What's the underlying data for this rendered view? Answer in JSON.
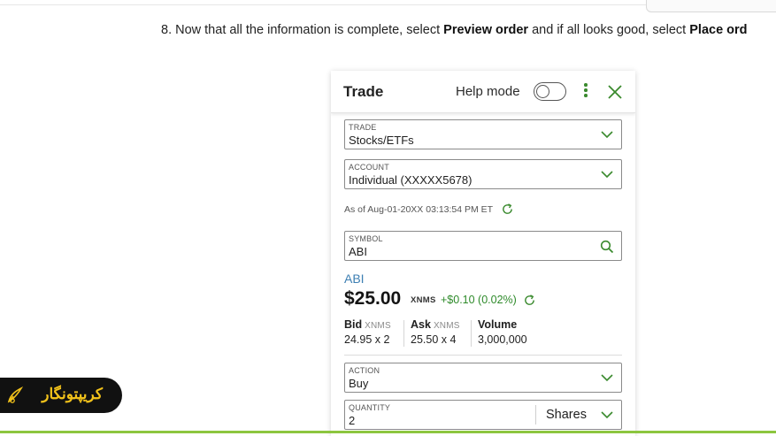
{
  "instruction": {
    "prefix": "8. Now that all the information is complete, select ",
    "preview_label": "Preview order",
    "middle": " and if all looks good, select ",
    "place_label": "Place ord"
  },
  "panel": {
    "title": "Trade",
    "help_mode_label": "Help mode",
    "help_mode_on": false
  },
  "trade_field": {
    "label": "TRADE",
    "value": "Stocks/ETFs"
  },
  "account_field": {
    "label": "ACCOUNT",
    "value": "Individual (XXXXX5678)"
  },
  "as_of": "As of Aug-01-20XX 03:13:54 PM ET",
  "symbol_field": {
    "label": "SYMBOL",
    "value": "ABI"
  },
  "quote": {
    "symbol_link": "ABI",
    "price": "$25.00",
    "exchange": "XNMS",
    "change": "+$0.10 (0.02%)",
    "bid_label": "Bid",
    "bid_exchange": "XNMS",
    "bid_value": "24.95 x 2",
    "ask_label": "Ask",
    "ask_exchange": "XNMS",
    "ask_value": "25.50 x 4",
    "volume_label": "Volume",
    "volume_value": "3,000,000"
  },
  "action_field": {
    "label": "ACTION",
    "value": "Buy"
  },
  "quantity_field": {
    "label": "QUANTITY",
    "value": "2",
    "unit": "Shares"
  },
  "watermark": {
    "text": "کریپتونگار"
  },
  "colors": {
    "accent_green": "#3a8a2e",
    "link_blue": "#3d7fb3",
    "change_green": "#2e8a2a",
    "bottom_rule": "#8cc63f",
    "watermark_gold": "#f2c21b"
  }
}
